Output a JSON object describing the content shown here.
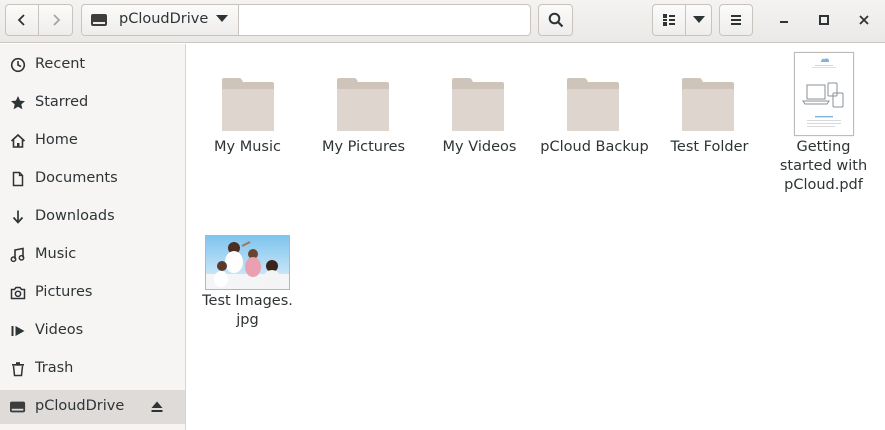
{
  "header": {
    "path_label": "pCloudDrive",
    "colors": {
      "accent": "#2e3436",
      "folder": "#ddd4cc"
    }
  },
  "sidebar": {
    "items": [
      {
        "label": "Recent",
        "icon": "clock-icon"
      },
      {
        "label": "Starred",
        "icon": "star-icon"
      },
      {
        "label": "Home",
        "icon": "home-icon"
      },
      {
        "label": "Documents",
        "icon": "document-icon"
      },
      {
        "label": "Downloads",
        "icon": "download-icon"
      },
      {
        "label": "Music",
        "icon": "music-icon"
      },
      {
        "label": "Pictures",
        "icon": "camera-icon"
      },
      {
        "label": "Videos",
        "icon": "video-icon"
      },
      {
        "label": "Trash",
        "icon": "trash-icon"
      },
      {
        "label": "pCloudDrive",
        "icon": "drive-icon",
        "active": true
      }
    ]
  },
  "files": [
    {
      "name": "My Music",
      "type": "folder"
    },
    {
      "name": "My Pictures",
      "type": "folder"
    },
    {
      "name": "My Videos",
      "type": "folder"
    },
    {
      "name": "pCloud Backup",
      "type": "folder"
    },
    {
      "name": "Test Folder",
      "type": "folder"
    },
    {
      "name_lines": [
        "Getting",
        "started with",
        "pCloud.pdf"
      ],
      "type": "pdf"
    },
    {
      "name_lines": [
        "Test Images.",
        "jpg"
      ],
      "type": "image"
    }
  ]
}
